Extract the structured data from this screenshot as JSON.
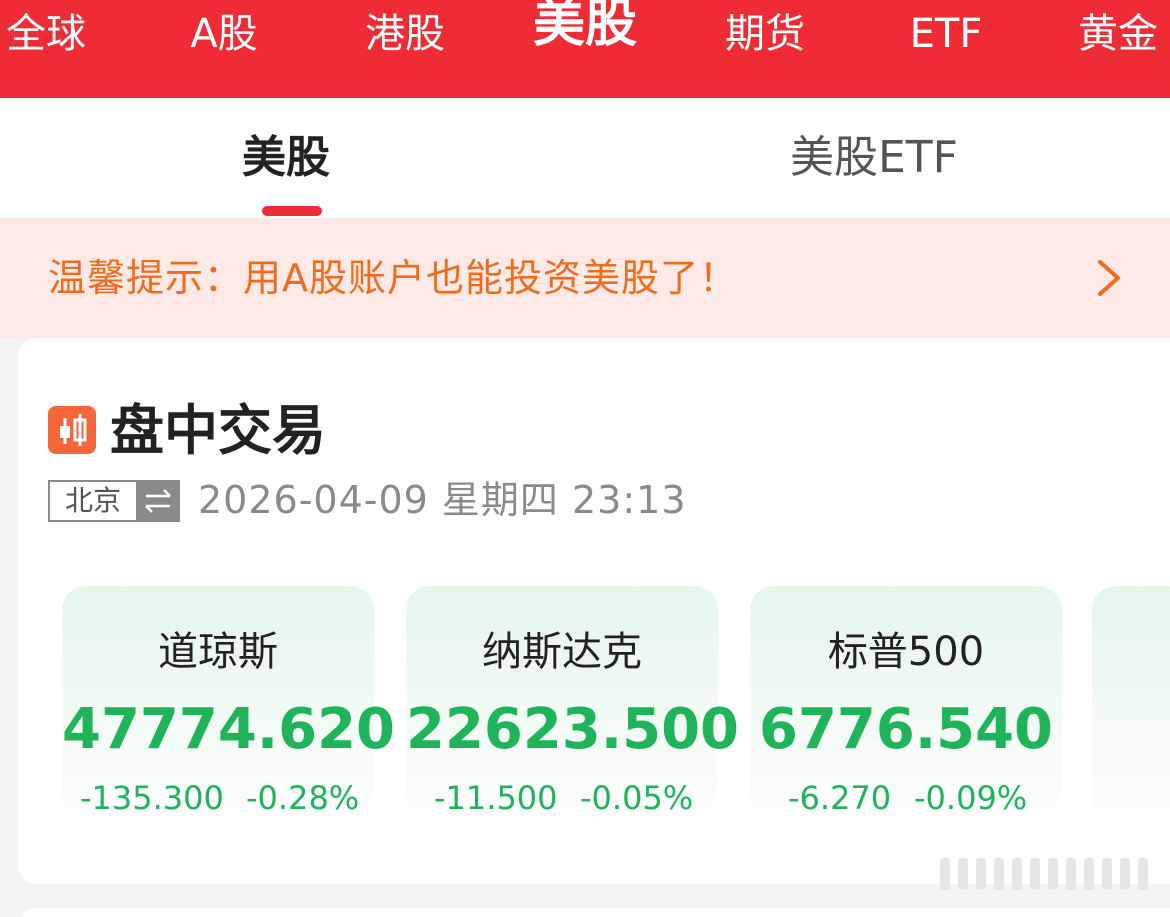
{
  "market_tabs": {
    "global": "全球",
    "a_share": "A股",
    "hk": "港股",
    "us": "美股",
    "futures": "期货",
    "etf": "ETF",
    "gold": "黄金",
    "active": "美股"
  },
  "sub_tabs": {
    "us_stocks": "美股",
    "us_etf": "美股ETF",
    "active": "美股"
  },
  "notice": {
    "text": "温馨提示：用A股账户也能投资美股了！"
  },
  "session": {
    "title": "盘中交易",
    "timezone": "北京",
    "datetime": "2026-04-09 星期四  23:13"
  },
  "indices": [
    {
      "name": "道琼斯",
      "value": "47774.620",
      "change": "-135.300",
      "change_pct": "-0.28%"
    },
    {
      "name": "纳斯达克",
      "value": "22623.500",
      "change": "-11.500",
      "change_pct": "-0.05%"
    },
    {
      "name": "标普500",
      "value": "6776.540",
      "change": "-6.270",
      "change_pct": "-0.09%"
    }
  ],
  "colors": {
    "brand_red": "#ef2b35",
    "notice_orange": "#f26b1c",
    "down_green": "#1fb35a"
  },
  "icons": [
    "candlestick-icon",
    "swap-icon",
    "chevron-right-icon"
  ]
}
